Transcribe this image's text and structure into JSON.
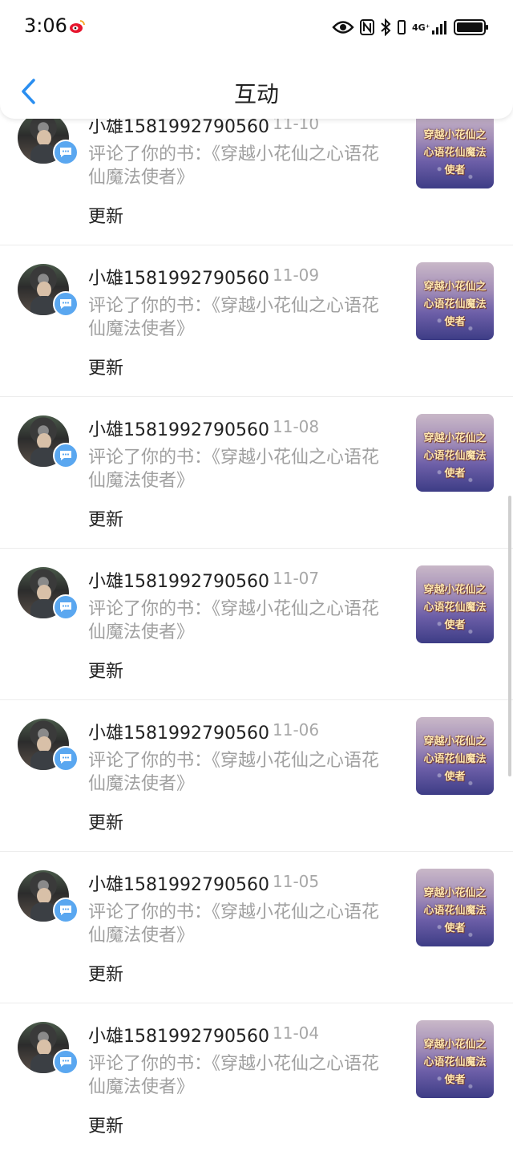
{
  "status_bar": {
    "time": "3:06",
    "network": "4G⁺",
    "icons": [
      "weibo-icon",
      "eye-icon",
      "nfc-icon",
      "bluetooth-icon",
      "vibrate-icon",
      "signal-icon",
      "battery-icon"
    ]
  },
  "header": {
    "title": "互动",
    "back_icon": "chevron-left-icon"
  },
  "colors": {
    "accent": "#2a8ef0",
    "badge": "#5aa7f0",
    "secondary_text": "#a0a0a0"
  },
  "book": {
    "cover_title_line1": "穿越小花仙之",
    "cover_title_line2": "心语花仙魔法使者"
  },
  "interactions": [
    {
      "user": "小雄1581992790560",
      "date": "11-10",
      "comment": "评论了你的书：《穿越小花仙之心语花仙魔法使者》",
      "action": "更新"
    },
    {
      "user": "小雄1581992790560",
      "date": "11-09",
      "comment": "评论了你的书：《穿越小花仙之心语花仙魔法使者》",
      "action": "更新"
    },
    {
      "user": "小雄1581992790560",
      "date": "11-08",
      "comment": "评论了你的书：《穿越小花仙之心语花仙魔法使者》",
      "action": "更新"
    },
    {
      "user": "小雄1581992790560",
      "date": "11-07",
      "comment": "评论了你的书：《穿越小花仙之心语花仙魔法使者》",
      "action": "更新"
    },
    {
      "user": "小雄1581992790560",
      "date": "11-06",
      "comment": "评论了你的书：《穿越小花仙之心语花仙魔法使者》",
      "action": "更新"
    },
    {
      "user": "小雄1581992790560",
      "date": "11-05",
      "comment": "评论了你的书：《穿越小花仙之心语花仙魔法使者》",
      "action": "更新"
    },
    {
      "user": "小雄1581992790560",
      "date": "11-04",
      "comment": "评论了你的书：《穿越小花仙之心语花仙魔法使者》",
      "action": "更新"
    }
  ]
}
